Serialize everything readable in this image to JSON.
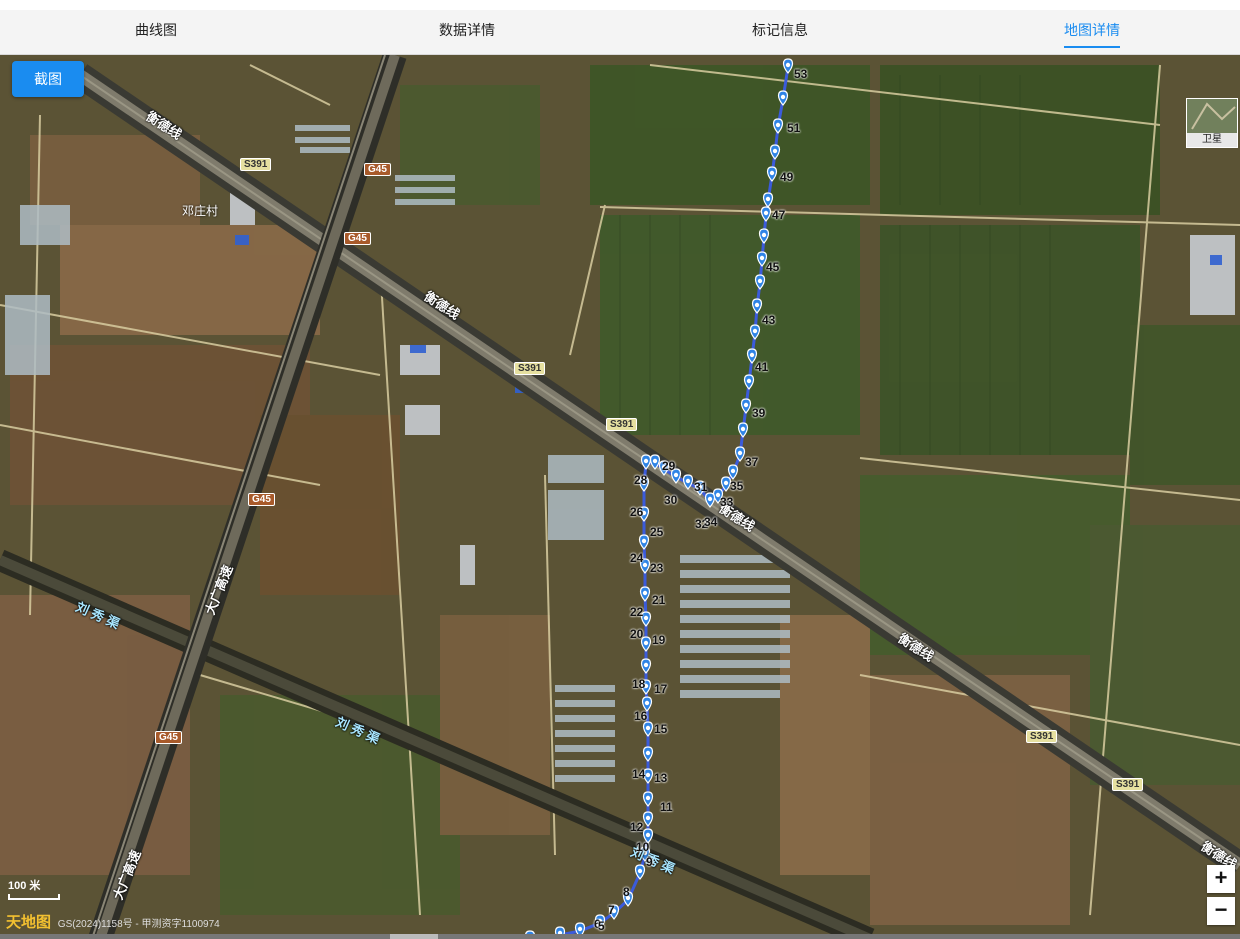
{
  "tabs": [
    {
      "label": "曲线图",
      "active": false
    },
    {
      "label": "数据详情",
      "active": false
    },
    {
      "label": "标记信息",
      "active": false
    },
    {
      "label": "地图详情",
      "active": true
    }
  ],
  "map": {
    "screenshot_button": "截图",
    "layer_button": "卫星",
    "zoom_in": "+",
    "zoom_out": "−",
    "scale_text": "100 米",
    "credit_logo": "天地图",
    "credit_text": "GS(2024)1158号 - 甲测资字1100974",
    "village_name": "邓庄村",
    "roads": {
      "hengde": "衡德线",
      "daguang": "大广高速",
      "canal": "刘 秀 渠",
      "g45": "G45",
      "s391": "S391"
    },
    "track_labels": [
      "53",
      "51",
      "49",
      "47",
      "45",
      "43",
      "41",
      "39",
      "37",
      "35",
      "31",
      "29",
      "30",
      "33",
      "32",
      "34",
      "28",
      "26",
      "25",
      "24",
      "23",
      "21",
      "22",
      "20",
      "19",
      "18",
      "17",
      "16",
      "15",
      "14",
      "13",
      "12",
      "11",
      "10",
      "9",
      "8",
      "7",
      "6",
      "5"
    ],
    "track_color": "#3b5bdb",
    "accent_color": "#1a8cf0"
  }
}
